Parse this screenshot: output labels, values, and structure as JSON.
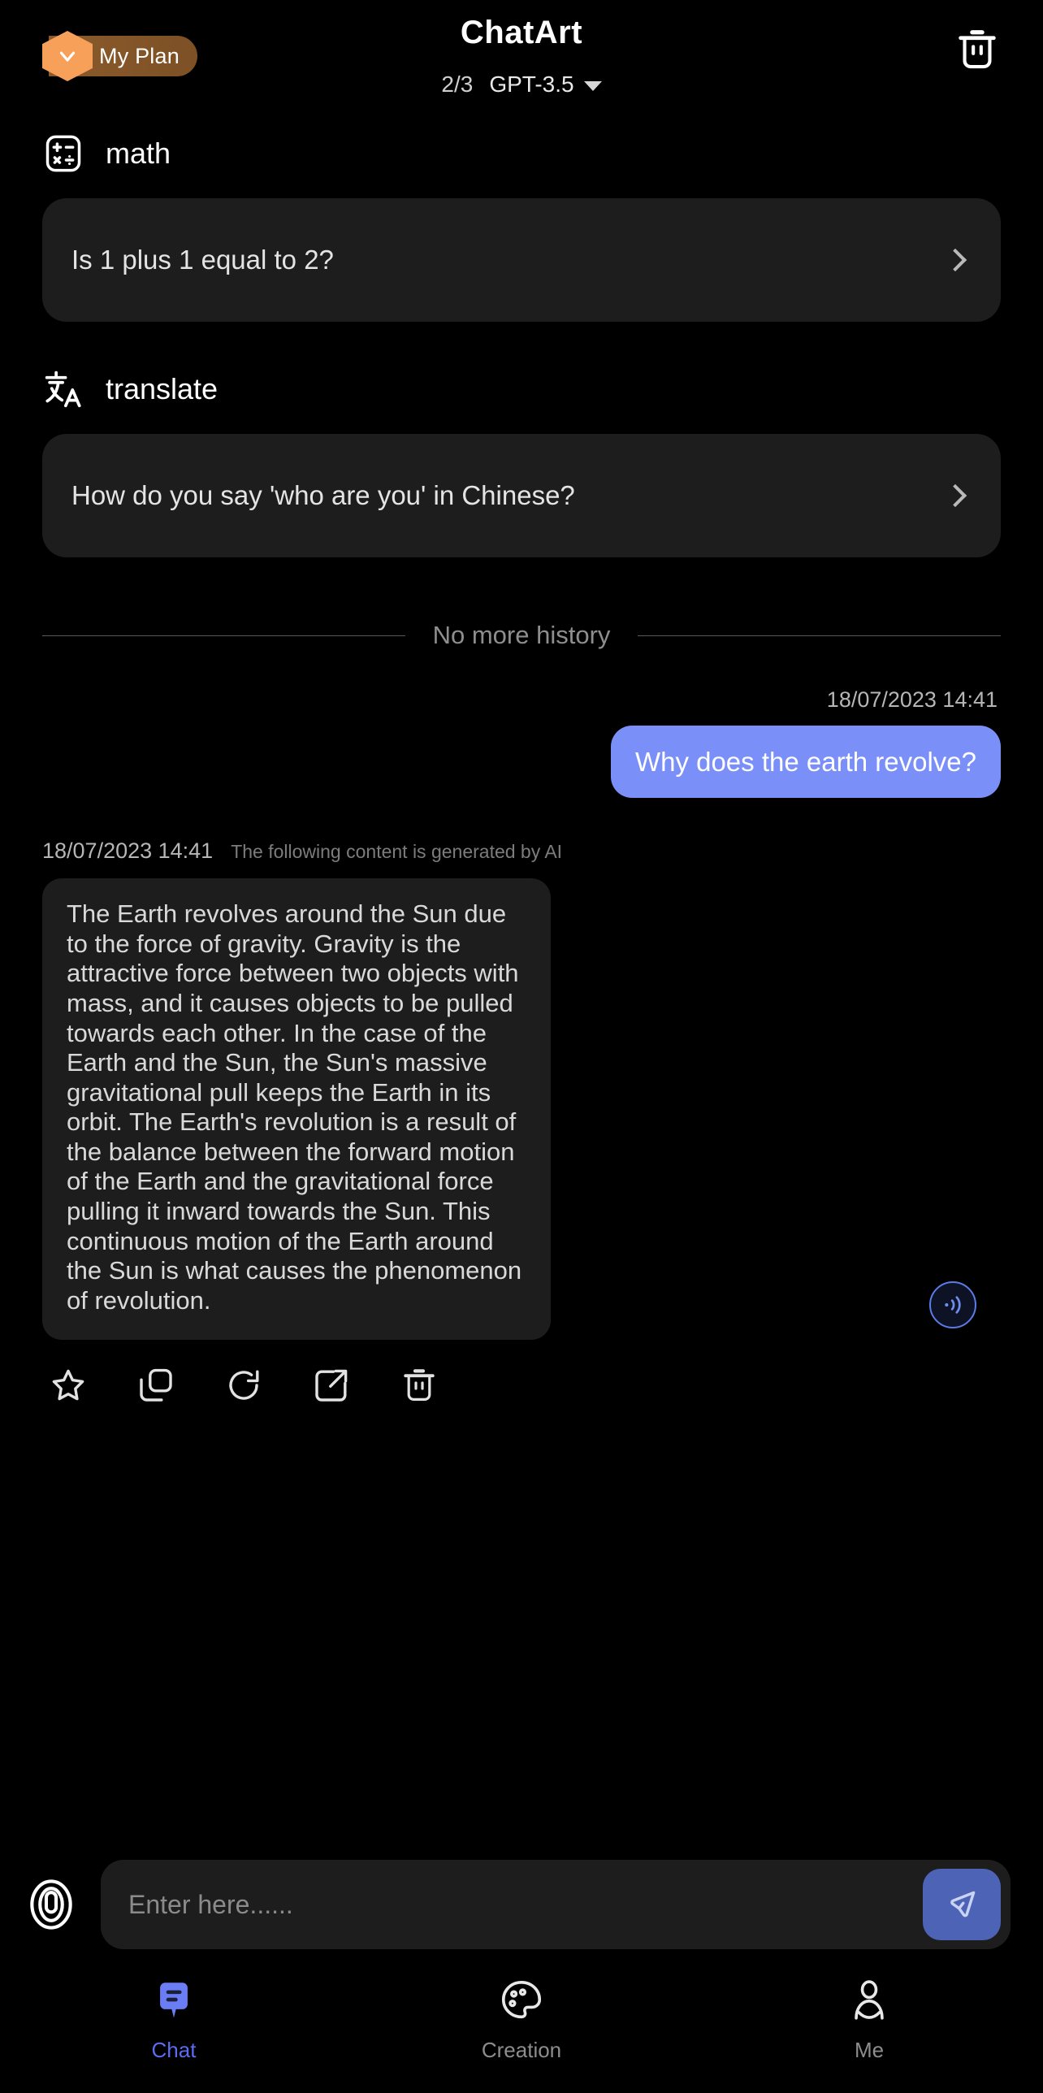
{
  "header": {
    "plan_badge_label": "My Plan",
    "plan_badge_icon": "chevron-down-hex-icon",
    "app_title": "ChatArt",
    "message_count": "2/3",
    "model_name": "GPT-3.5",
    "model_dropdown_icon": "chevron-down-icon",
    "clear_icon": "trash-icon",
    "accent_orange": "#f6a05a",
    "badge_brown": "#8a5a2b"
  },
  "suggestions": [
    {
      "section_icon": "calculator-icon",
      "section_label": "math",
      "question": "Is 1 plus 1 equal to 2?",
      "chevron_icon": "chevron-right-icon"
    },
    {
      "section_icon": "translate-icon",
      "section_label": "translate",
      "question": "How do you say 'who are you' in Chinese?",
      "chevron_icon": "chevron-right-icon"
    }
  ],
  "history_divider": {
    "label": "No more history"
  },
  "conversation": {
    "user_message": {
      "timestamp": "18/07/2023 14:41",
      "text": "Why does the earth revolve?",
      "bubble_color": "#7a8ff8"
    },
    "ai_message": {
      "timestamp": "18/07/2023 14:41",
      "disclaimer": "The following content is generated by AI",
      "text": "The Earth revolves around the Sun due to the force of gravity. Gravity is the attractive force between two objects with mass, and it causes objects to be pulled towards each other. In the case of the Earth and the Sun, the Sun's massive gravitational pull keeps the Earth in its orbit. The Earth's revolution is a result of the balance between the forward motion of the Earth and the gravitational force pulling it inward towards the Sun. This continuous motion of the Earth around the Sun is what causes the phenomenon of revolution.",
      "speak_icon": "speaker-wave-icon",
      "speak_accent_color": "#5b7ce8",
      "actions": [
        {
          "icon": "star-icon",
          "name": "favorite"
        },
        {
          "icon": "copy-icon",
          "name": "copy"
        },
        {
          "icon": "refresh-icon",
          "name": "regenerate"
        },
        {
          "icon": "share-icon",
          "name": "share"
        },
        {
          "icon": "trash-icon",
          "name": "delete"
        }
      ]
    }
  },
  "input_bar": {
    "mic_icon": "microphone-icon",
    "placeholder": "Enter here......",
    "value": "",
    "send_icon": "send-paper-plane-icon",
    "send_button_color": "#4d63b6"
  },
  "tabbar": {
    "active_color": "#5b6cf0",
    "inactive_color": "#8d8d8d",
    "tabs": [
      {
        "label": "Chat",
        "icon": "chat-bubble-icon",
        "active": true
      },
      {
        "label": "Creation",
        "icon": "palette-icon",
        "active": false
      },
      {
        "label": "Me",
        "icon": "person-icon",
        "active": false
      }
    ]
  }
}
